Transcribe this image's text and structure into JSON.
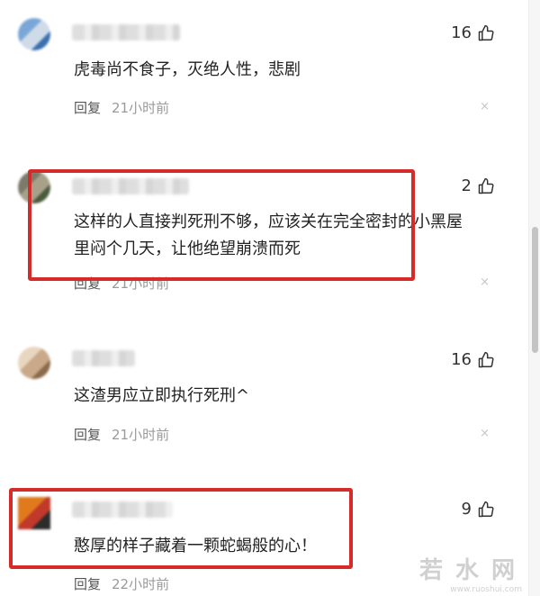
{
  "comments": [
    {
      "likes": "16",
      "text": "虎毒尚不食子，灭绝人性，悲剧",
      "reply": "回复",
      "time": "21小时前",
      "avatar_colors": [
        "#7aa7d8",
        "#cfdbe8",
        "#3a6fb0"
      ]
    },
    {
      "likes": "2",
      "text": "这样的人直接判死刑不够，应该关在完全密封的小黑屋里闷个几天，让他绝望崩溃而死",
      "reply": "回复",
      "time": "21小时前",
      "avatar_colors": [
        "#7d7a6a",
        "#a8a18a",
        "#4b5a3c"
      ],
      "highlighted": true
    },
    {
      "likes": "16",
      "text": "这渣男应立即执行死刑^",
      "reply": "回复",
      "time": "21小时前",
      "avatar_colors": [
        "#e9d6c0",
        "#c9a98a",
        "#8a6a4a"
      ]
    },
    {
      "likes": "9",
      "text": "憨厚的样子藏着一颗蛇蝎般的心！",
      "reply": "回复",
      "time": "22小时前",
      "avatar_colors": [
        "#e07a1c",
        "#c0392b",
        "#2c2c2c"
      ],
      "highlighted": true
    }
  ],
  "close_glyph": "×",
  "watermark": {
    "text": "若水网",
    "url": "www.ruoshui.com"
  },
  "highlight_color": "#d62b2b"
}
